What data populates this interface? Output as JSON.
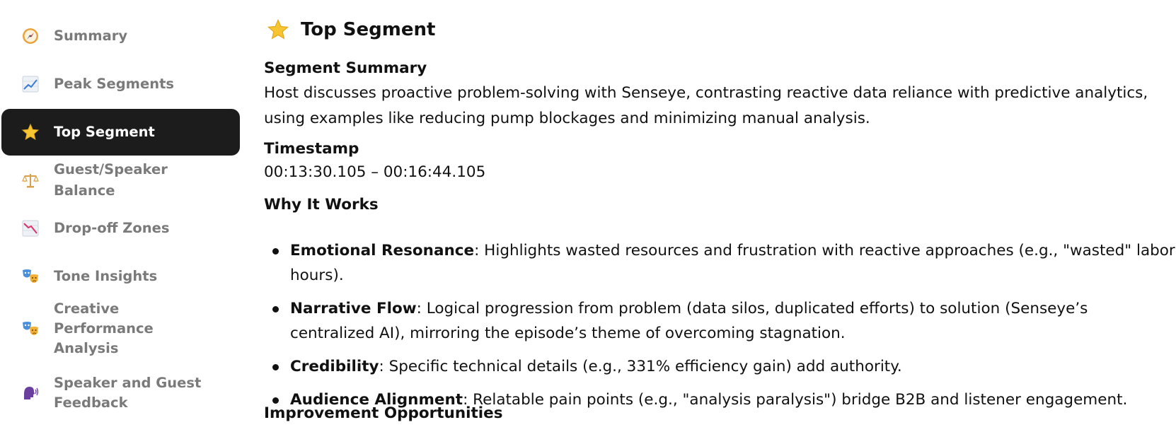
{
  "sidebar": {
    "items": [
      {
        "label": "Summary",
        "icon": "compass-icon",
        "active": false
      },
      {
        "label": "Peak Segments",
        "icon": "chart-increasing-icon",
        "active": false
      },
      {
        "label": "Top Segment",
        "icon": "star-icon",
        "active": true
      },
      {
        "label": "Guest/Speaker Balance",
        "icon": "balance-scale-icon",
        "active": false
      },
      {
        "label": "Drop-off Zones",
        "icon": "chart-decreasing-icon",
        "active": false
      },
      {
        "label": "Tone Insights",
        "icon": "performing-arts-icon",
        "active": false
      },
      {
        "label": "Creative Performance Analysis",
        "icon": "performing-arts-icon",
        "active": false
      },
      {
        "label": "Speaker and Guest Feedback",
        "icon": "speaking-head-icon",
        "active": false
      }
    ]
  },
  "main": {
    "title": "Top Segment",
    "title_icon": "star-icon",
    "segment_summary": {
      "heading": "Segment Summary",
      "text": "Host discusses proactive problem-solving with Senseye, contrasting reactive data reliance with predictive analytics, using examples like reducing pump blockages and minimizing manual analysis."
    },
    "timestamp": {
      "heading": "Timestamp",
      "value": "00:13:30.105 – 00:16:44.105"
    },
    "why_it_works": {
      "heading": "Why It Works",
      "items": [
        {
          "term": "Emotional Resonance",
          "text": ": Highlights wasted resources and frustration with reactive approaches (e.g., \"wasted\" labor hours)."
        },
        {
          "term": "Narrative Flow",
          "text": ": Logical progression from problem (data silos, duplicated efforts) to solution (Senseye’s centralized AI), mirroring the episode’s theme of overcoming stagnation."
        },
        {
          "term": "Credibility",
          "text": ": Specific technical details (e.g., 331% efficiency gain) add authority."
        },
        {
          "term": "Audience Alignment",
          "text": ": Relatable pain points (e.g., \"analysis paralysis\") bridge B2B and listener engagement."
        }
      ]
    },
    "improvement": {
      "heading": "Improvement Opportunities"
    }
  },
  "colors": {
    "active_bg": "#1c1c1c",
    "inactive_text": "#7a7a7a",
    "active_text": "#ffffff"
  }
}
